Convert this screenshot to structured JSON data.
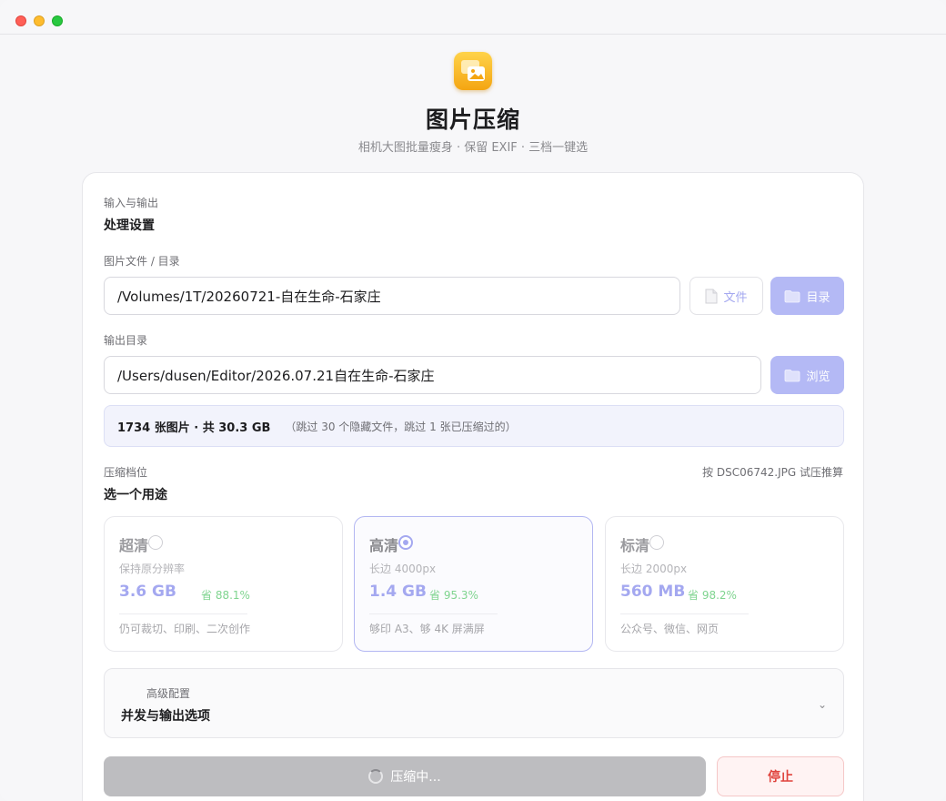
{
  "app": {
    "title": "图片压缩",
    "subtitle": "相机大图批量瘦身 · 保留 EXIF · 三档一键选"
  },
  "io": {
    "kicker": "输入与输出",
    "title": "处理设置",
    "source_label": "图片文件 / 目录",
    "source_value": "/Volumes/1T/20260721-自在生命-石家庄",
    "file_button": "文件",
    "dir_button": "目录",
    "output_label": "输出目录",
    "output_value": "/Users/dusen/Editor/2026.07.21自在生命-石家庄",
    "browse_button": "浏览",
    "summary_main": "1734 张图片 · 共 30.3 GB",
    "summary_note": "（跳过 30 个隐藏文件，跳过 1 张已压缩过的）"
  },
  "compression": {
    "kicker": "压缩档位",
    "title": "选一个用途",
    "estimate_note": "按 DSC06742.JPG 试压推算",
    "selected": "high",
    "tiers": [
      {
        "id": "ultra",
        "name": "超清",
        "desc": "保持原分辨率",
        "size": "3.6 GB",
        "save": "省 88.1%",
        "use": "仍可裁切、印刷、二次创作"
      },
      {
        "id": "high",
        "name": "高清",
        "desc": "长边 4000px",
        "size": "1.4 GB",
        "save": "省 95.3%",
        "use": "够印 A3、够 4K 屏满屏"
      },
      {
        "id": "standard",
        "name": "标清",
        "desc": "长边 2000px",
        "size": "560 MB",
        "save": "省 98.2%",
        "use": "公众号、微信、网页"
      }
    ]
  },
  "advanced": {
    "kicker": "高级配置",
    "title": "并发与输出选项",
    "chevron": "⌄"
  },
  "actions": {
    "progress_label": "压缩中...",
    "stop_label": "停止"
  },
  "colors": {
    "accent": "#a4a8f0",
    "accent_button": "#b4b9f5",
    "save_green": "#7fd48f",
    "stop_red": "#e0443e"
  },
  "icons": {
    "app": "photo-stack-icon",
    "file": "document-icon",
    "folder": "folder-icon",
    "spinner": "spinner-icon"
  }
}
